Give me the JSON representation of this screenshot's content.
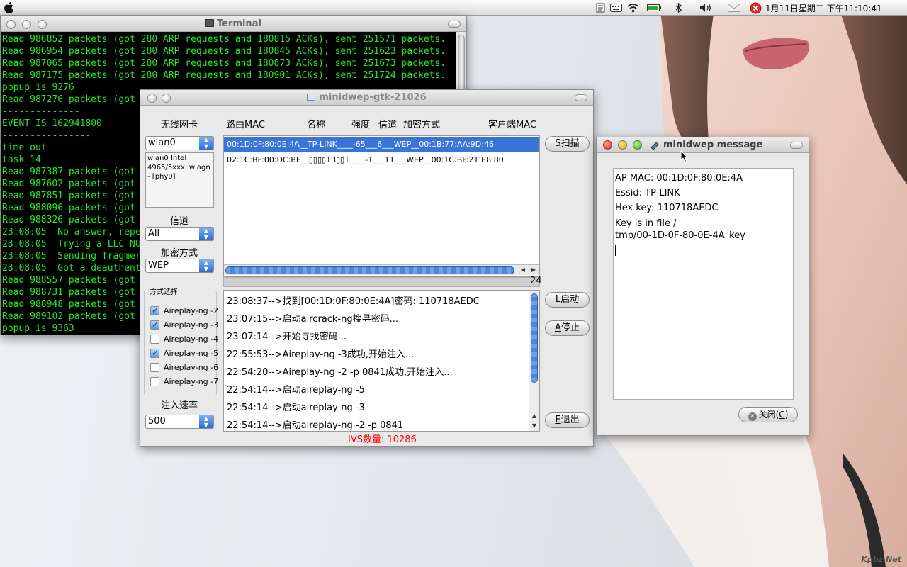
{
  "menubar": {
    "clock": "1月11日星期二 下午11:10:41"
  },
  "terminal": {
    "title": "Terminal",
    "lines": [
      "Read 986852 packets (got 280 ARP requests and 180815 ACKs), sent 251571 packets.",
      "Read 986954 packets (got 280 ARP requests and 180845 ACKs), sent 251623 packets.",
      "Read 987065 packets (got 280 ARP requests and 180873 ACKs), sent 251673 packets.",
      "Read 987175 packets (got 280 ARP requests and 180901 ACKs), sent 251724 packets.",
      "popup is 9276",
      "Read 987276 packets (got",
      "--------------",
      "EVENT IS 162941800",
      "----------------",
      "time out",
      "task 14",
      "Read 987387 packets (got",
      "Read 987602 packets (got",
      "Read 987851 packets (got",
      "Read 988096 packets (got",
      "Read 988326 packets (got",
      "23:08:05  No answer, repe",
      "23:08:05  Trying a LLC NU",
      "23:08:05  Sending fragmer",
      "23:08:05  Got a deauthent",
      "Read 988557 packets (got",
      "Read 988731 packets (got",
      "Read 988948 packets (got",
      "Read 989102 packets (got",
      "popup is 9363"
    ]
  },
  "minidwep": {
    "title": "minidwep-gtk-21026",
    "wireless_label": "无线网卡",
    "interface_value": "wlan0",
    "interface_info": "wlan0 Intel 4965/5xxx iwlagn - [phy0]",
    "channel_label": "信道",
    "channel_value": "All",
    "encryption_label": "加密方式",
    "encryption_value": "WEP",
    "method_label": "方式选择",
    "methods": [
      {
        "label": "Aireplay-ng -2",
        "checked": true
      },
      {
        "label": "Aireplay-ng -3",
        "checked": true
      },
      {
        "label": "Aireplay-ng -4",
        "checked": false
      },
      {
        "label": "Aireplay-ng -5",
        "checked": true
      },
      {
        "label": "Aireplay-ng -6",
        "checked": false
      },
      {
        "label": "Aireplay-ng -7",
        "checked": false
      }
    ],
    "rate_label": "注入速率",
    "rate_value": "500",
    "columns": {
      "mac": "路由MAC",
      "name": "名称",
      "strength": "强度",
      "channel": "信道",
      "encryption": "加密方式",
      "client": "客户端MAC"
    },
    "ap_rows": [
      "00:1D:0F:80:0E:4A__TP-LINK____-65___6___WEP__00:1B:77:AA:9D:46",
      "02:1C:BF:00:DC:BE__▯▯▯▯13▯▯1____-1___11___WEP__00:1C:BF:21:E8:80"
    ],
    "progress_count": "24",
    "buttons": {
      "scan_key": "S",
      "scan_text": "扫描",
      "start_key": "L",
      "start_text": "启动",
      "stop_key": "A",
      "stop_text": "停止",
      "exit_key": "E",
      "exit_text": "退出"
    },
    "log": [
      "23:08:37-->找到[00:1D:0F:80:0E:4A]密码: 110718AEDC",
      "23:07:15-->启动aircrack-ng搜寻密码...",
      "23:07:14-->开始寻找密码...",
      "22:55:53-->Aireplay-ng -3成功,开始注入...",
      "22:54:20-->Aireplay-ng -2 -p 0841成功,开始注入...",
      "22:54:14-->启动aireplay-ng -5",
      "22:54:14-->启动aireplay-ng -3",
      "22:54:14-->启动aireplay-ng -2 -p 0841"
    ],
    "ivs": "IVS数量: 10286",
    "ivs_color": "#ff0000"
  },
  "message": {
    "title": "minidwep message",
    "lines": [
      "AP MAC: 00:1D:0F:80:0E:4A",
      "Essid: TP-LINK",
      "Hex key:  110718AEDC",
      "Key is in file /",
      "tmp/00-1D-0F-80-0E-4A_key"
    ],
    "close_label": "关闭(",
    "close_key": "C",
    "close_end": ")"
  },
  "watermark": "Kpbz.Net"
}
